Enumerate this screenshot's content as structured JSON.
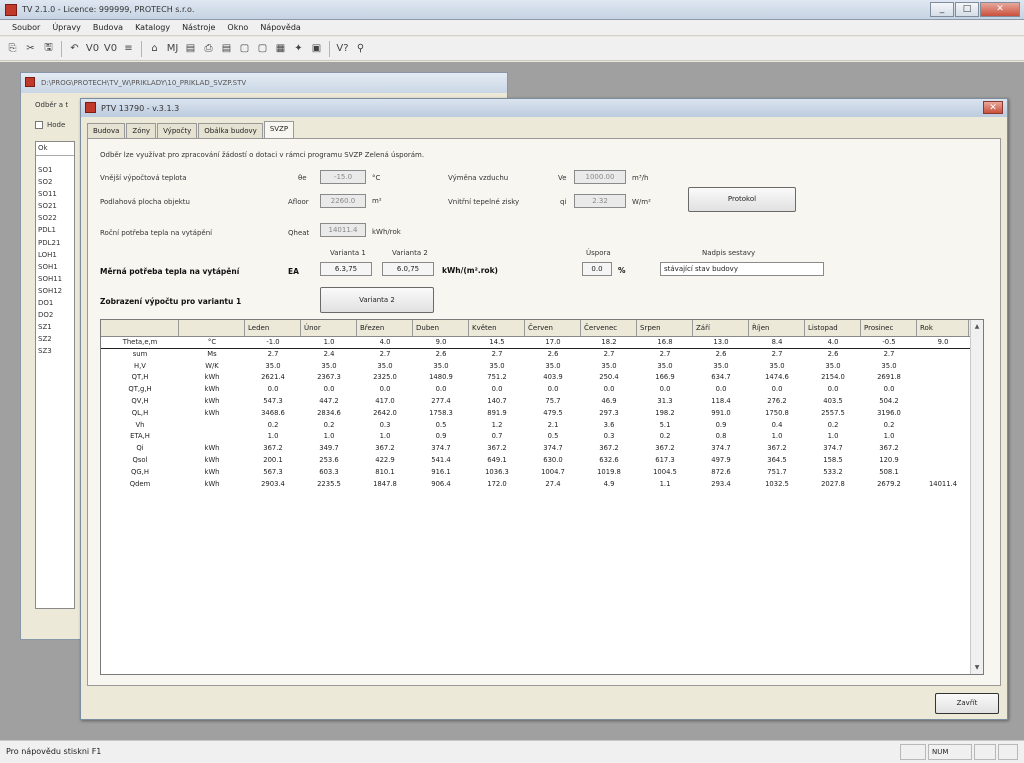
{
  "app": {
    "title": "TV 2.1.0 - Licence: 999999, PROTECH s.r.o.",
    "min": "_",
    "max": "□",
    "close": "✕"
  },
  "menu": [
    "Soubor",
    "Úpravy",
    "Budova",
    "Katalogy",
    "Nástroje",
    "Okno",
    "Nápověda"
  ],
  "toolbar_icons": [
    "⎘",
    "✂",
    "⎗",
    "🖫",
    "↶",
    "V0",
    "V0",
    "≡",
    "⌂",
    "MJ",
    "▤",
    "⎙",
    "▤",
    "▢",
    "▢",
    "▦",
    "✦",
    "▣",
    "▢",
    "V?",
    "⚲"
  ],
  "docwin": {
    "title": "D:\\PROG\\PROTECH\\TV_W\\PRIKLADY\\10_PRIKLAD_SVZP.STV",
    "line1": "Odběr a t",
    "checkbox_label": "Hode",
    "listhead": "Ok",
    "list": [
      "SO1",
      "SO2",
      "SO11",
      "SO21",
      "SO22",
      "PDL1",
      "PDL21",
      "LOH1",
      "SOH1",
      "SOH11",
      "SOH12",
      "DO1",
      "DO2",
      "SZ1",
      "SZ2",
      "SZ3"
    ]
  },
  "dialog": {
    "title": "PTV 13790 - v.3.1.3",
    "close": "✕",
    "tabs": [
      "Budova",
      "Zóny",
      "Výpočty",
      "Obálka budovy",
      "SVZP"
    ],
    "active_tab": 4,
    "desc": "Odběr lze využívat pro zpracování žádostí o dotaci v rámci programu SVZP Zelená úsporám.",
    "labels": {
      "theta_e": "Vnější výpočtová teplota",
      "theta_sym": "θe",
      "theta_val": "-15.0",
      "theta_unit": "°C",
      "area": "Podlahová plocha objektu",
      "area_sym": "Afloor",
      "area_val": "2260.0",
      "area_unit": "m²",
      "annual": "Roční potřeba tepla na vytápění",
      "annual_sym": "Qheat",
      "annual_val": "14011.4",
      "annual_unit": "kWh/rok",
      "vent": "Výměna vzduchu",
      "vent_sym": "Ve",
      "vent_val": "1000.00",
      "vent_unit": "m³/h",
      "gains": "Vnitřní tepelné zisky",
      "gains_sym": "qi",
      "gains_val": "2.32",
      "gains_unit": "W/m²",
      "protocol_btn": "Protokol",
      "variant1": "Varianta 1",
      "variant2": "Varianta 2",
      "specific": "Měrná potřeba tepla na vytápění",
      "specific_sym": "EA",
      "v1_val": "6.3,75",
      "v2_val": "6.0,75",
      "specific_unit": "kWh/(m².rok)",
      "savings": "Úspora",
      "savings_val": "0.0",
      "savings_unit": "%",
      "state_label": "Nadpis sestavy",
      "state_val": "stávající stav budovy",
      "results": "Zobrazení výpočtu pro variantu 1",
      "variant2_btn": "Varianta 2"
    },
    "grid": {
      "headers": [
        "",
        "",
        "Leden",
        "Únor",
        "Březen",
        "Duben",
        "Květen",
        "Červen",
        "Červenec",
        "Srpen",
        "Září",
        "Říjen",
        "Listopad",
        "Prosinec",
        "Rok"
      ],
      "rows": [
        [
          "Theta,e,m",
          "°C",
          "-1.0",
          "1.0",
          "4.0",
          "9.0",
          "14.5",
          "17.0",
          "18.2",
          "16.8",
          "13.0",
          "8.4",
          "4.0",
          "-0.5",
          "9.0"
        ],
        [
          "sum",
          "Ms",
          "2.7",
          "2.4",
          "2.7",
          "2.6",
          "2.7",
          "2.6",
          "2.7",
          "2.7",
          "2.6",
          "2.7",
          "2.6",
          "2.7",
          ""
        ],
        [
          "H,V",
          "W/K",
          "35.0",
          "35.0",
          "35.0",
          "35.0",
          "35.0",
          "35.0",
          "35.0",
          "35.0",
          "35.0",
          "35.0",
          "35.0",
          "35.0",
          ""
        ],
        [
          "QT,H",
          "kWh",
          "2621.4",
          "2367.3",
          "2325.0",
          "1480.9",
          "751.2",
          "403.9",
          "250.4",
          "166.9",
          "634.7",
          "1474.6",
          "2154.0",
          "2691.8",
          ""
        ],
        [
          "QT,g,H",
          "kWh",
          "0.0",
          "0.0",
          "0.0",
          "0.0",
          "0.0",
          "0.0",
          "0.0",
          "0.0",
          "0.0",
          "0.0",
          "0.0",
          "0.0",
          ""
        ],
        [
          "QV,H",
          "kWh",
          "547.3",
          "447.2",
          "417.0",
          "277.4",
          "140.7",
          "75.7",
          "46.9",
          "31.3",
          "118.4",
          "276.2",
          "403.5",
          "504.2",
          ""
        ],
        [
          "QL,H",
          "kWh",
          "3468.6",
          "2834.6",
          "2642.0",
          "1758.3",
          "891.9",
          "479.5",
          "297.3",
          "198.2",
          "991.0",
          "1750.8",
          "2557.5",
          "3196.0",
          ""
        ],
        [
          "Vh",
          "",
          "0.2",
          "0.2",
          "0.3",
          "0.5",
          "1.2",
          "2.1",
          "3.6",
          "5.1",
          "0.9",
          "0.4",
          "0.2",
          "0.2",
          ""
        ],
        [
          "ETA,H",
          "",
          "1.0",
          "1.0",
          "1.0",
          "0.9",
          "0.7",
          "0.5",
          "0.3",
          "0.2",
          "0.8",
          "1.0",
          "1.0",
          "1.0",
          ""
        ],
        [
          "Qi",
          "kWh",
          "367.2",
          "349.7",
          "367.2",
          "374.7",
          "367.2",
          "374.7",
          "367.2",
          "367.2",
          "374.7",
          "367.2",
          "374.7",
          "367.2",
          ""
        ],
        [
          "Qsol",
          "kWh",
          "200.1",
          "253.6",
          "422.9",
          "541.4",
          "649.1",
          "630.0",
          "632.6",
          "617.3",
          "497.9",
          "364.5",
          "158.5",
          "120.9",
          ""
        ],
        [
          "QG,H",
          "kWh",
          "567.3",
          "603.3",
          "810.1",
          "916.1",
          "1036.3",
          "1004.7",
          "1019.8",
          "1004.5",
          "872.6",
          "751.7",
          "533.2",
          "508.1",
          ""
        ],
        [
          "Qdem",
          "kWh",
          "2903.4",
          "2235.5",
          "1847.8",
          "906.4",
          "172.0",
          "27.4",
          "4.9",
          "1.1",
          "293.4",
          "1032.5",
          "2027.8",
          "2679.2",
          "14011.4"
        ]
      ]
    },
    "close_btn": "Zavřít"
  },
  "status": {
    "text": "Pro nápovědu stiskni F1",
    "num": "NUM"
  }
}
